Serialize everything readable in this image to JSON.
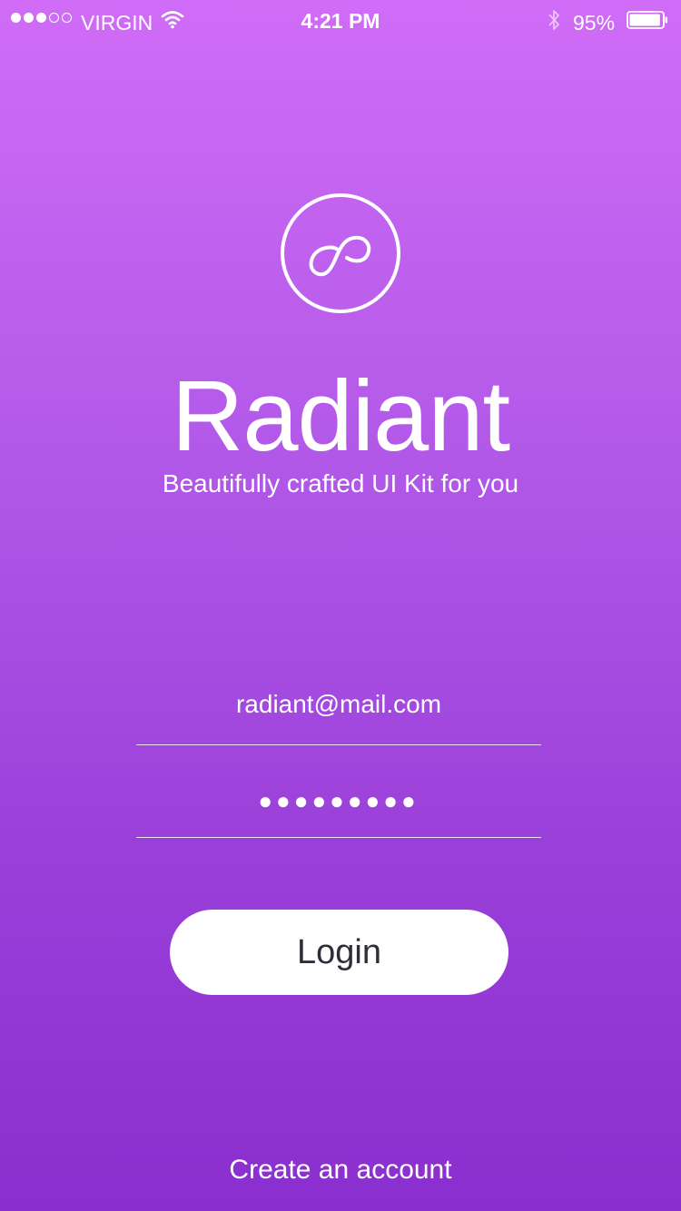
{
  "status_bar": {
    "signal_filled": 3,
    "signal_total": 5,
    "carrier": "VIRGIN",
    "time": "4:21 PM",
    "battery_percent": "95%",
    "battery_level": 0.95
  },
  "brand": {
    "logo_icon": "infinity-link-icon",
    "title": "Radiant",
    "tagline": "Beautifully crafted UI Kit for you"
  },
  "form": {
    "email_value": "radiant@mail.com",
    "password_mask": "●●●●●●●●●",
    "login_label": "Login"
  },
  "footer": {
    "create_account_label": "Create an account"
  },
  "colors": {
    "gradient_top": "#d06cf7",
    "gradient_bottom": "#8a2ecf",
    "button_bg": "#ffffff",
    "button_text": "#2e2e3a"
  }
}
